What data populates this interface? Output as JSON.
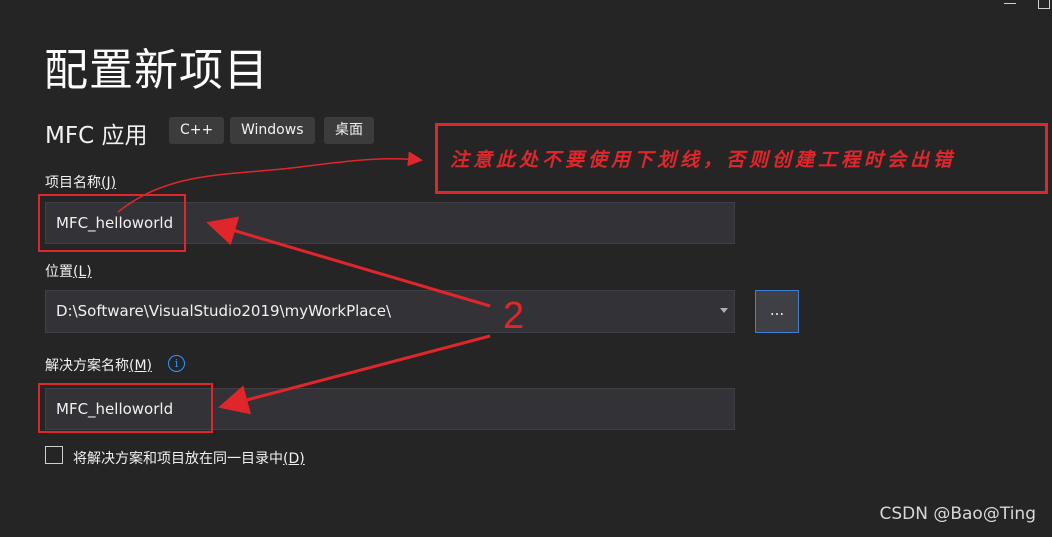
{
  "header": {
    "title": "配置新项目"
  },
  "template": {
    "name": "MFC 应用",
    "tags": [
      "C++",
      "Windows",
      "桌面"
    ]
  },
  "form": {
    "project_name": {
      "label": "项目名称(J)",
      "label_main": "项目名称",
      "label_key": "(J)",
      "value": "MFC_helloworld"
    },
    "location": {
      "label": "位置(L)",
      "label_main": "位置",
      "label_key": "(L)",
      "value": "D:\\Software\\VisualStudio2019\\myWorkPlace\\",
      "browse_label": "..."
    },
    "solution_name": {
      "label": "解决方案名称(M)",
      "label_main": "解决方案名称",
      "label_key": "(M)",
      "value": "MFC_helloworld",
      "info_glyph": "i"
    },
    "same_directory": {
      "label": "将解决方案和项目放在同一目录中(D)",
      "label_main": "将解决方案和项目放在同一目录中",
      "label_key": "(D)",
      "checked": false
    }
  },
  "annotations": {
    "note": "注意此处不要使用下划线，否则创建工程时会出错",
    "step": "2",
    "color": "#e0262b"
  },
  "watermark": "CSDN @Bao@Ting"
}
